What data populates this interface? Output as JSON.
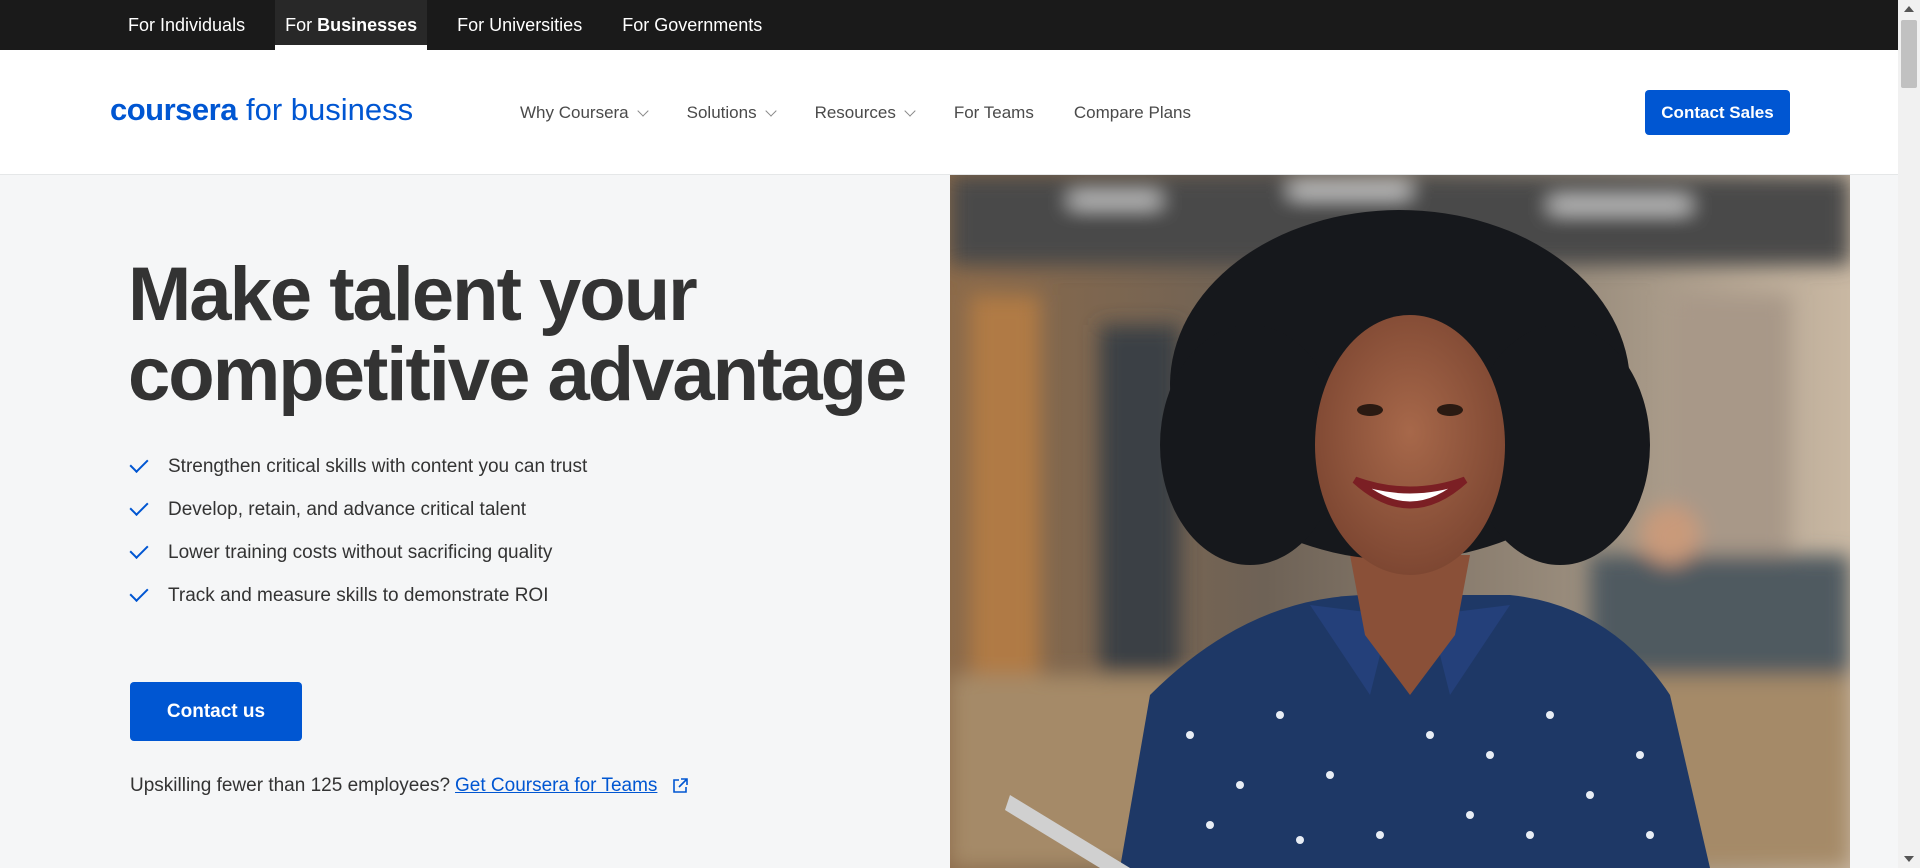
{
  "audience_tabs": [
    {
      "prefix": "For",
      "label": "Individuals",
      "active": false
    },
    {
      "prefix": "For",
      "label": "Businesses",
      "active": true
    },
    {
      "prefix": "For",
      "label": "Universities",
      "active": false
    },
    {
      "prefix": "For",
      "label": "Governments",
      "active": false
    }
  ],
  "logo": {
    "word": "coursera",
    "suffix": "for business"
  },
  "nav": {
    "items": [
      {
        "label": "Why Coursera",
        "dropdown": true
      },
      {
        "label": "Solutions",
        "dropdown": true
      },
      {
        "label": "Resources",
        "dropdown": true
      },
      {
        "label": "For Teams",
        "dropdown": false
      },
      {
        "label": "Compare Plans",
        "dropdown": false
      }
    ],
    "cta": "Contact Sales"
  },
  "hero": {
    "title_line1": "Make talent your",
    "title_line2": "competitive advantage",
    "benefits": [
      "Strengthen critical skills with content you can trust",
      "Develop, retain, and advance critical talent",
      "Lower training costs without sacrificing quality",
      "Track and measure skills to demonstrate ROI"
    ],
    "cta": "Contact us",
    "teams_prompt": "Upskilling fewer than 125 employees?",
    "teams_link": "Get Coursera for Teams"
  },
  "colors": {
    "brand": "#0056d2",
    "topbar": "#1a1a1a",
    "hero_bg": "#f5f6f7",
    "heading": "#333333"
  },
  "icons": {
    "benefit": "checkmark-icon",
    "nav_dropdown": "chevron-down-icon",
    "link": "external-link-icon"
  }
}
